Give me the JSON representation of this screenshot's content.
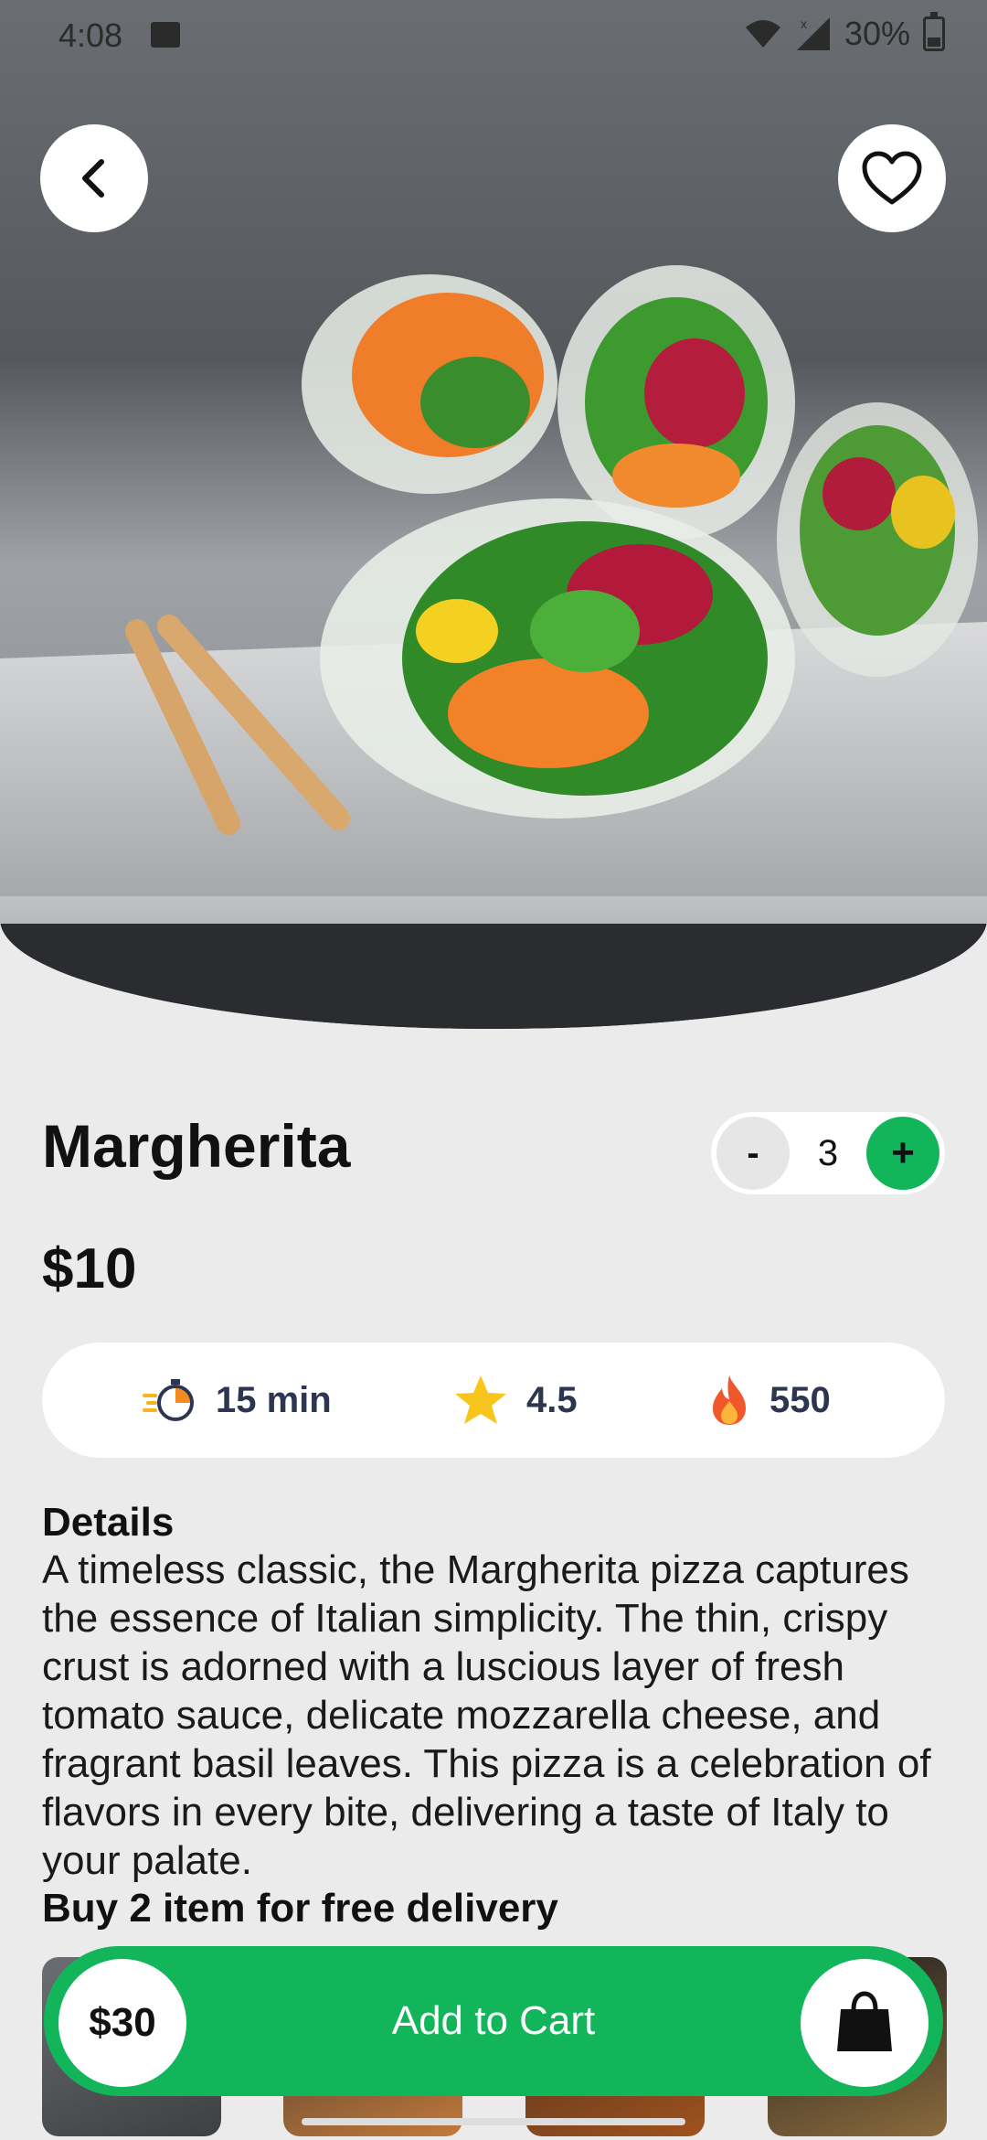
{
  "status_bar": {
    "time": "4:08",
    "battery": "30%",
    "icons": [
      "image-icon",
      "wifi-icon",
      "signal-icon",
      "battery-icon"
    ]
  },
  "hero": {
    "image": "spring-rolls-photo"
  },
  "nav": {
    "back_icon": "chevron-left-icon",
    "favorite_icon": "heart-icon"
  },
  "product": {
    "name": "Margherita",
    "price": "$10",
    "quantity": {
      "minus_label": "-",
      "value": "3",
      "plus_label": "+"
    }
  },
  "stats": {
    "time": {
      "icon": "stopwatch-icon",
      "label": "15 min"
    },
    "rating": {
      "icon": "star-icon",
      "label": "4.5"
    },
    "calories": {
      "icon": "flame-icon",
      "label": "550"
    }
  },
  "details": {
    "title": "Details",
    "text": "A timeless classic, the Margherita pizza captures the essence of Italian simplicity. The thin, crispy crust is adorned with a luscious layer of fresh tomato sauce, delicate mozzarella cheese, and fragrant basil leaves. This pizza is a celebration of flavors in every bite, delivering a taste of Italy to your palate.",
    "promo": "Buy 2 item for free delivery"
  },
  "cart": {
    "total": "$30",
    "label": "Add to Cart",
    "icon": "shopping-bag-icon"
  },
  "colors": {
    "accent": "#12b55a",
    "background": "#ebebeb",
    "stat_text": "#2c3650"
  }
}
